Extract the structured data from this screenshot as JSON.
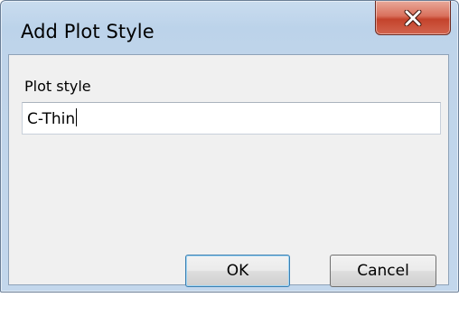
{
  "window": {
    "title": "Add Plot Style",
    "close_icon": "close-x-icon"
  },
  "form": {
    "label": "Plot style",
    "input_value": "C-Thin"
  },
  "buttons": {
    "ok_label": "OK",
    "cancel_label": "Cancel"
  },
  "colors": {
    "frame": "#bfd4ea",
    "close_button": "#c4432c",
    "client_background": "#f0f0f0",
    "default_button_border": "#3c7fb1"
  }
}
